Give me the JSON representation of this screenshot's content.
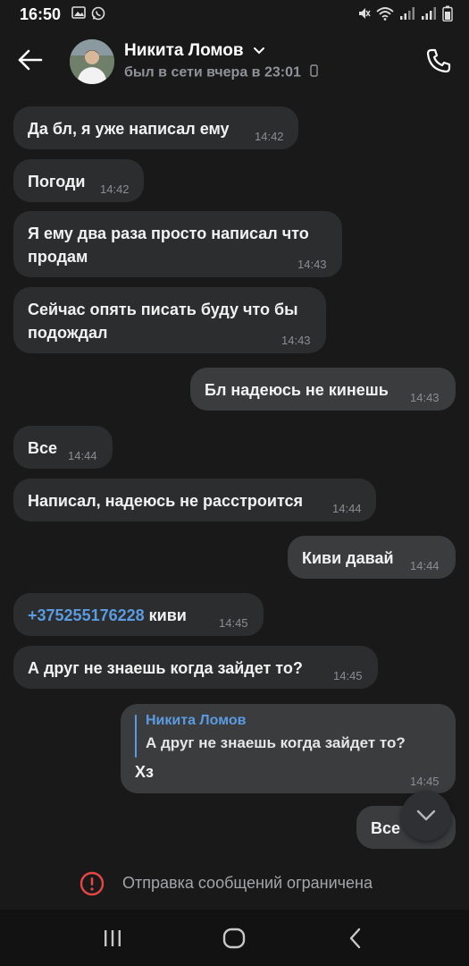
{
  "status_bar": {
    "time": "16:50",
    "left_icons": [
      "gallery-icon",
      "whatsapp-icon"
    ],
    "right_icons": [
      "mute-icon",
      "wifi-icon",
      "signal-icon",
      "signal-icon",
      "battery-icon"
    ]
  },
  "header": {
    "name": "Никита Ломов",
    "status": "был в сети вчера в 23:01",
    "icons": [
      "back-arrow-icon",
      "chevron-down-icon",
      "phone-device-icon",
      "phone-call-icon"
    ]
  },
  "messages": [
    {
      "dir": "in",
      "lines": [
        "Да бл, я уже написал ему"
      ],
      "time": "14:42"
    },
    {
      "dir": "in",
      "lines": [
        "Погоди"
      ],
      "time": "14:42"
    },
    {
      "dir": "in",
      "lines": [
        "Я ему два раза просто написал что",
        "продам"
      ],
      "time": "14:43"
    },
    {
      "dir": "in",
      "lines": [
        "Сейчас опять писать буду что бы",
        "подождал"
      ],
      "time": "14:43"
    },
    {
      "dir": "out",
      "lines": [
        "Бл надеюсь не кинешь"
      ],
      "time": "14:43"
    },
    {
      "dir": "in",
      "lines": [
        "Все"
      ],
      "time": "14:44"
    },
    {
      "dir": "in",
      "lines": [
        "Написал, надеюсь не расстроится"
      ],
      "time": "14:44"
    },
    {
      "dir": "out",
      "lines": [
        "Киви давай"
      ],
      "time": "14:44"
    },
    {
      "dir": "in",
      "phone": "+375255176228",
      "text": "киви",
      "time": "14:45"
    },
    {
      "dir": "in",
      "lines": [
        "А друг не знаешь когда зайдет то?"
      ],
      "time": "14:45"
    },
    {
      "dir": "out",
      "reply_author": "Никита Ломов",
      "reply_text": "А друг не знаешь когда зайдет то?",
      "lines": [
        "Хз"
      ],
      "time": "14:45"
    },
    {
      "dir": "out",
      "lines": [
        "Все"
      ],
      "time": ""
    }
  ],
  "restriction": {
    "text": "Отправка сообщений ограничена",
    "icon": "alert-circle-icon",
    "color": "#e64646"
  },
  "nav_bar": {
    "icons": [
      "recent-apps-icon",
      "home-icon",
      "back-icon"
    ]
  },
  "colors": {
    "background": "#191919",
    "bubble_in": "#2c2d2e",
    "bubble_out": "#3b3c3e",
    "accent": "#5a9be2"
  }
}
